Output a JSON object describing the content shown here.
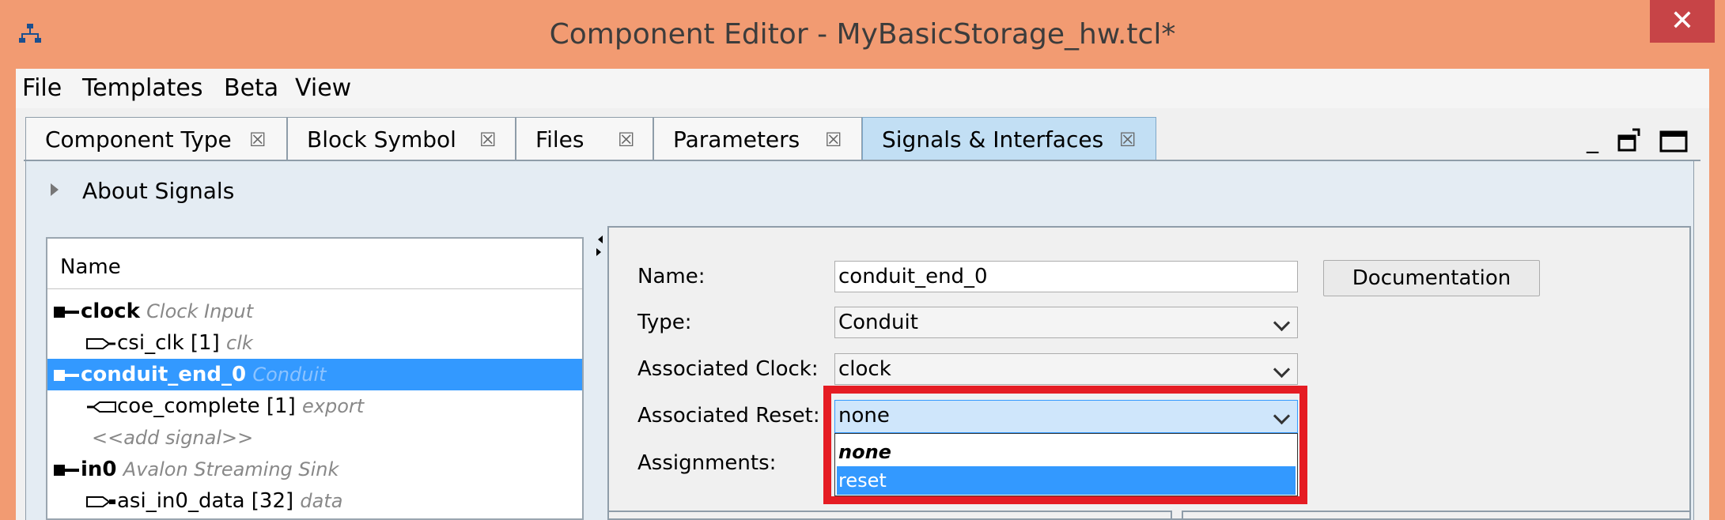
{
  "window": {
    "title": "Component Editor - MyBasicStorage_hw.tcl*",
    "close_label": "✕"
  },
  "menu": [
    "File",
    "Templates",
    "Beta",
    "View"
  ],
  "tabs": [
    {
      "label": "Component Type"
    },
    {
      "label": "Block Symbol"
    },
    {
      "label": "Files"
    },
    {
      "label": "Parameters"
    },
    {
      "label": "Signals & Interfaces",
      "active": true
    }
  ],
  "tab_close_glyph": "☒",
  "window_controls": {
    "minimize": "_"
  },
  "about": {
    "label": "About Signals"
  },
  "signal_list": {
    "header": "Name",
    "rows": [
      {
        "name": "clock",
        "type": "Clock Input",
        "kind": "interface"
      },
      {
        "name": "csi_clk [1]",
        "type": "clk",
        "kind": "signal-in"
      },
      {
        "name": "conduit_end_0",
        "type": "Conduit",
        "kind": "interface",
        "selected": true
      },
      {
        "name": "coe_complete [1]",
        "type": "export",
        "kind": "signal-out"
      },
      {
        "name": "<<add signal>>",
        "type": "",
        "kind": "add"
      },
      {
        "name": "in0",
        "type": "Avalon Streaming Sink",
        "kind": "interface"
      },
      {
        "name": "asi_in0_data [32]",
        "type": "data",
        "kind": "signal-in"
      }
    ]
  },
  "form": {
    "name_label": "Name:",
    "name_value": "conduit_end_0",
    "type_label": "Type:",
    "type_value": "Conduit",
    "clock_label": "Associated Clock:",
    "clock_value": "clock",
    "reset_label": "Associated Reset:",
    "reset_value": "none",
    "assignments_label": "Assignments:",
    "documentation_button": "Documentation",
    "reset_options": [
      "none",
      "reset"
    ],
    "highlight_color": "#e51c23"
  },
  "colors": {
    "titlebar": "#f29b72",
    "selection": "#3399ff",
    "close_button": "#c74447"
  }
}
